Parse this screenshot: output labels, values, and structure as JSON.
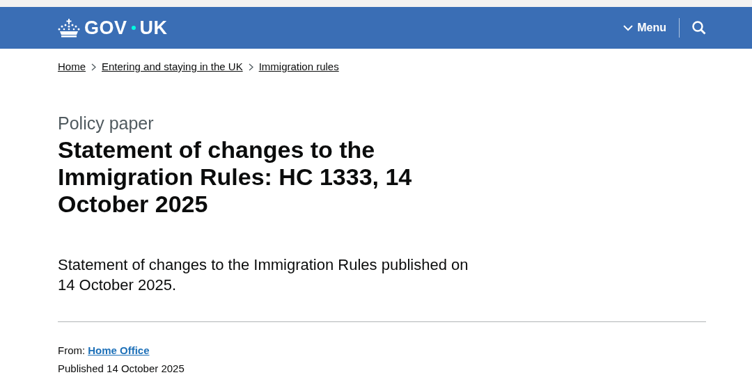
{
  "header": {
    "logo_parts": [
      "GOV",
      "UK"
    ],
    "menu": {
      "label": "Menu",
      "expanded": false
    }
  },
  "breadcrumbs": [
    {
      "label": "Home"
    },
    {
      "label": "Entering and staying in the UK"
    },
    {
      "label": "Immigration rules"
    }
  ],
  "caption": "Policy paper",
  "title": "Statement of changes to the Immigration Rules: HC 1333, 14 October 2025",
  "summary": "Statement of changes to the Immigration Rules published on 14 October 2025.",
  "metadata": {
    "from_label": "From:",
    "from_link": "Home Office",
    "published": "Published 14 October 2025"
  }
}
